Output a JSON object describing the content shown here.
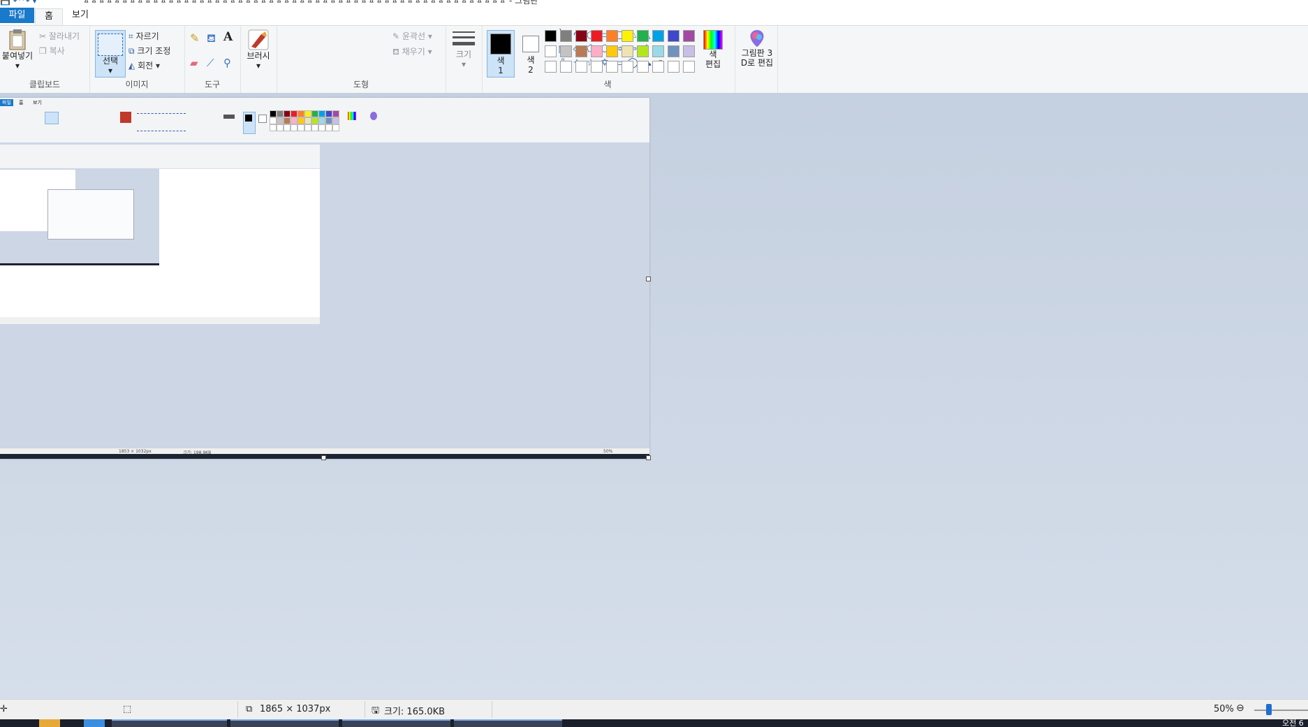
{
  "window": {
    "title": "ㅿㅿㅿㅿㅿㅿㅿㅿㅿㅿㅿㅿㅿㅿㅿㅿㅿㅿㅿㅿㅿㅿㅿㅿㅿㅿㅿㅿㅿㅿㅿㅿㅿㅿㅿㅿㅿㅿㅿㅿㅿㅿㅿㅿㅿㅿㅿㅿㅿㅿㅿㅿㅿㅿㅿ - 그림판",
    "quick_access": "💾 ↶ ↷ ▾"
  },
  "menu": {
    "file": "파일",
    "home": "홈",
    "view": "보기"
  },
  "ribbon": {
    "clipboard": {
      "paste": "붙여넣기",
      "cut": "잘라내기",
      "copy": "복사",
      "label": "클립보드"
    },
    "image": {
      "select": "선택",
      "crop": "자르기",
      "resize": "크기 조정",
      "rotate": "회전",
      "label": "이미지"
    },
    "tools": {
      "label": "도구"
    },
    "brush": {
      "label": "브러시"
    },
    "shapes": {
      "outline": "윤곽선",
      "fill": "채우기",
      "label": "도형"
    },
    "size": {
      "label": "크기"
    },
    "colors": {
      "color1_a": "색",
      "color1_b": "1",
      "color2_a": "색",
      "color2_b": "2",
      "edit_a": "색",
      "edit_b": "편집",
      "label": "색",
      "palette_row1": [
        "#000000",
        "#7f7f7f",
        "#880015",
        "#ed1c24",
        "#ff7f27",
        "#fff200",
        "#22b14c",
        "#00a2e8",
        "#3f48cc",
        "#a349a4"
      ],
      "palette_row2": [
        "#ffffff",
        "#c3c3c3",
        "#b97a57",
        "#ffaec9",
        "#ffc90e",
        "#efe4b0",
        "#b5e61d",
        "#99d9ea",
        "#7092be",
        "#c8bfe7"
      ],
      "palette_row3": [
        "#ffffff",
        "#ffffff",
        "#ffffff",
        "#ffffff",
        "#ffffff",
        "#ffffff",
        "#ffffff",
        "#ffffff",
        "#ffffff",
        "#ffffff"
      ]
    },
    "paint3d": {
      "line1": "그림판 3",
      "line2": "D로 편집"
    }
  },
  "canvas_inner": {
    "tab_file": "파일",
    "tab_home": "홈",
    "tab_view": "보기",
    "status_dims": "1853 × 1032px",
    "status_size": "크기: 198.9KB",
    "status_zoom": "50%"
  },
  "status": {
    "dimensions": "1865 × 1037px",
    "size": "크기: 165.0KB",
    "zoom": "50%"
  },
  "taskbar": {
    "clock": "오전 6"
  }
}
